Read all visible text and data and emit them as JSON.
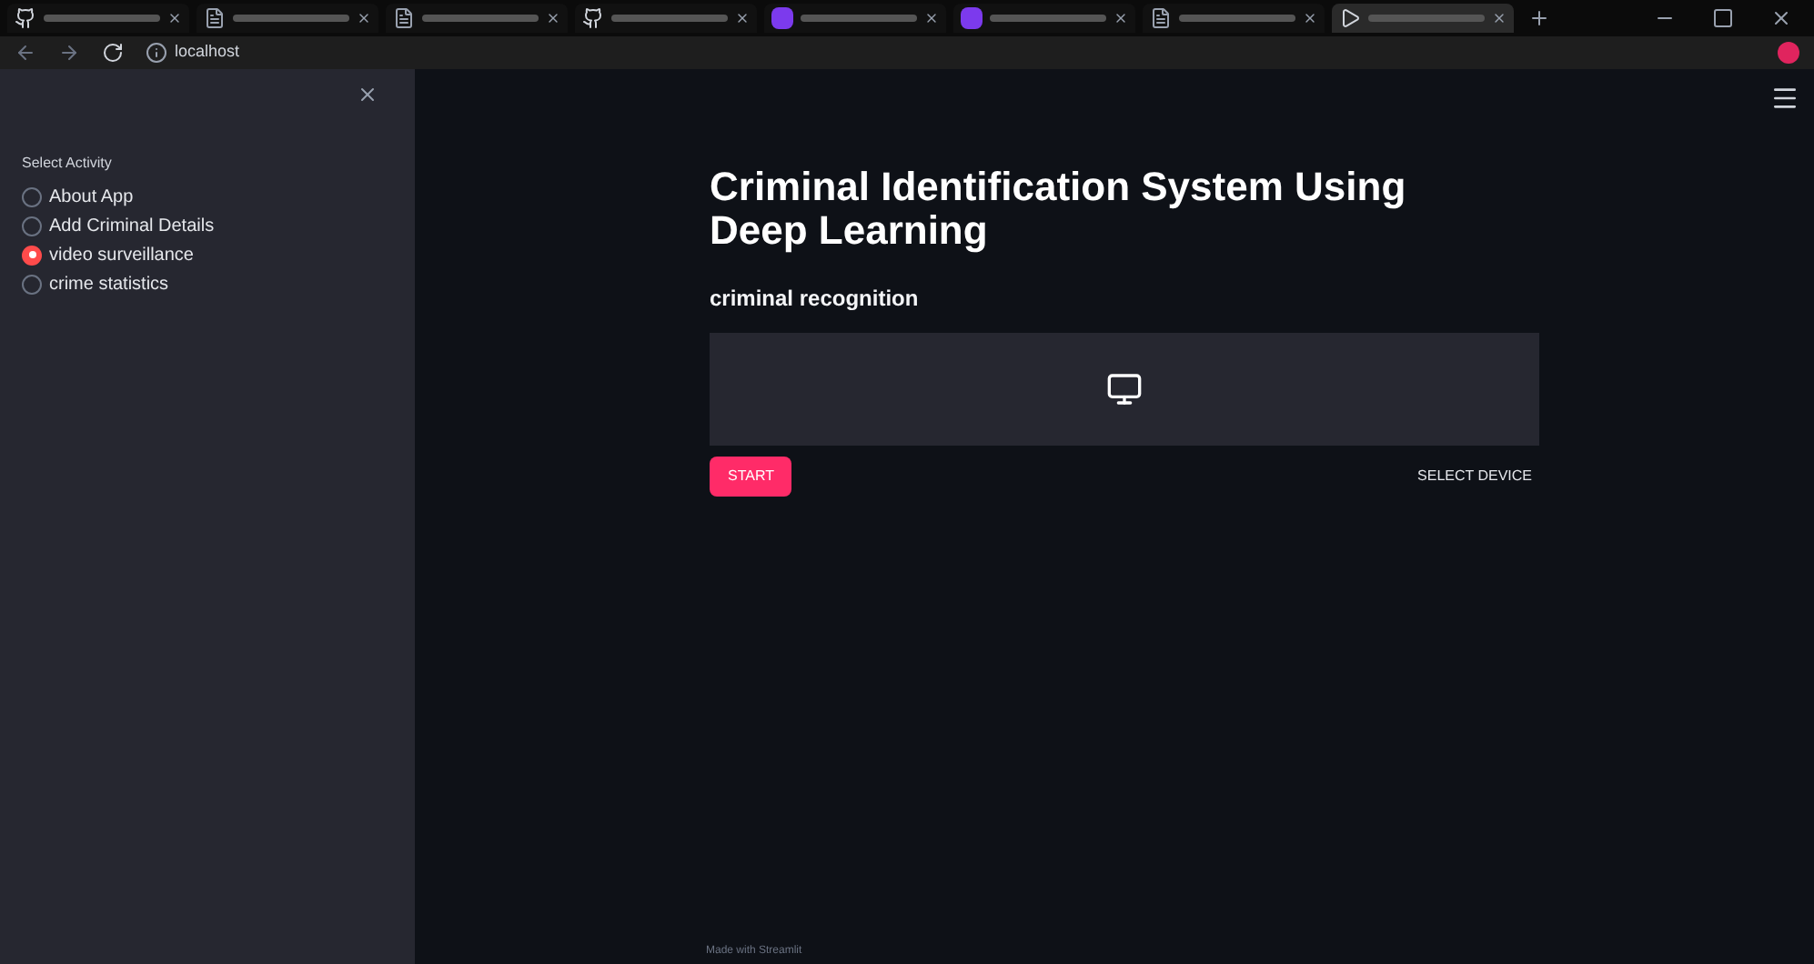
{
  "browser": {
    "tabs": [
      {
        "kind": "github",
        "selected": false
      },
      {
        "kind": "doc",
        "selected": false
      },
      {
        "kind": "doc",
        "selected": false
      },
      {
        "kind": "github",
        "selected": false
      },
      {
        "kind": "app",
        "selected": false
      },
      {
        "kind": "app",
        "selected": false
      },
      {
        "kind": "doc",
        "selected": false
      },
      {
        "kind": "video",
        "selected": true
      }
    ],
    "url": "localhost"
  },
  "sidebar": {
    "label": "Select Activity",
    "options": [
      {
        "label": "About App",
        "selected": false
      },
      {
        "label": "Add Criminal Details",
        "selected": false
      },
      {
        "label": "video surveillance",
        "selected": true
      },
      {
        "label": "crime statistics",
        "selected": false
      }
    ]
  },
  "main": {
    "title": "Criminal Identification System Using Deep Learning",
    "subheader": "criminal recognition",
    "start_button": "START",
    "select_device": "SELECT DEVICE",
    "footer": "Made with Streamlit"
  }
}
